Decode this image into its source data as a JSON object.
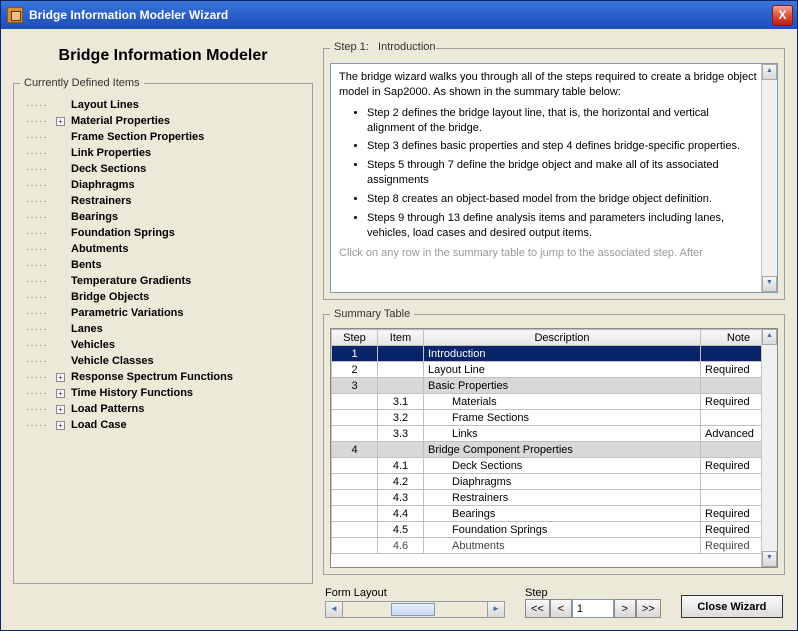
{
  "window": {
    "title": "Bridge Information Modeler Wizard",
    "close_x": "X"
  },
  "app": {
    "title": "Bridge Information Modeler"
  },
  "tree": {
    "legend": "Currently Defined Items",
    "items": [
      {
        "label": "Layout Lines",
        "expandable": false
      },
      {
        "label": "Material Properties",
        "expandable": true
      },
      {
        "label": "Frame Section Properties",
        "expandable": false
      },
      {
        "label": "Link Properties",
        "expandable": false
      },
      {
        "label": "Deck Sections",
        "expandable": false
      },
      {
        "label": "Diaphragms",
        "expandable": false
      },
      {
        "label": "Restrainers",
        "expandable": false
      },
      {
        "label": "Bearings",
        "expandable": false
      },
      {
        "label": "Foundation Springs",
        "expandable": false
      },
      {
        "label": "Abutments",
        "expandable": false
      },
      {
        "label": "Bents",
        "expandable": false
      },
      {
        "label": "Temperature Gradients",
        "expandable": false
      },
      {
        "label": "Bridge Objects",
        "expandable": false
      },
      {
        "label": "Parametric Variations",
        "expandable": false
      },
      {
        "label": "Lanes",
        "expandable": false
      },
      {
        "label": "Vehicles",
        "expandable": false
      },
      {
        "label": "Vehicle Classes",
        "expandable": false
      },
      {
        "label": "Response Spectrum Functions",
        "expandable": true
      },
      {
        "label": "Time History Functions",
        "expandable": true
      },
      {
        "label": "Load Patterns",
        "expandable": true
      },
      {
        "label": "Load Case",
        "expandable": true
      }
    ]
  },
  "step": {
    "header_prefix": "Step 1:",
    "header_title": "Introduction",
    "intro_para": "The bridge wizard walks you through all of the steps required to create a bridge object model in Sap2000. As shown in the summary table below:",
    "bullets": [
      "Step 2 defines the bridge layout line, that is, the horizontal and vertical alignment of the bridge.",
      "Step 3 defines basic properties and step 4 defines bridge-specific properties.",
      "Steps 5 through 7 define the bridge object and make all of its associated assignments",
      "Step 8 creates an object-based model from the bridge object definition.",
      "Steps 9 through 13 define analysis items and parameters including lanes, vehicles, load cases and desired output items."
    ],
    "cutoff": "Click on any row in the summary table to jump to the associated step. After"
  },
  "summary": {
    "legend": "Summary Table",
    "columns": {
      "step": "Step",
      "item": "Item",
      "description": "Description",
      "note": "Note"
    },
    "rows": [
      {
        "step": "1",
        "item": "",
        "desc": "Introduction",
        "note": "",
        "selected": true
      },
      {
        "step": "2",
        "item": "",
        "desc": "Layout Line",
        "note": "Required"
      },
      {
        "step": "3",
        "item": "",
        "desc": "Basic Properties",
        "note": "",
        "shade": true
      },
      {
        "step": "",
        "item": "3.1",
        "desc": "Materials",
        "note": "Required",
        "indent": true
      },
      {
        "step": "",
        "item": "3.2",
        "desc": "Frame Sections",
        "note": "",
        "indent": true
      },
      {
        "step": "",
        "item": "3.3",
        "desc": "Links",
        "note": "Advanced",
        "indent": true
      },
      {
        "step": "4",
        "item": "",
        "desc": "Bridge Component Properties",
        "note": "",
        "shade": true
      },
      {
        "step": "",
        "item": "4.1",
        "desc": "Deck Sections",
        "note": "Required",
        "indent": true
      },
      {
        "step": "",
        "item": "4.2",
        "desc": "Diaphragms",
        "note": "",
        "indent": true
      },
      {
        "step": "",
        "item": "4.3",
        "desc": "Restrainers",
        "note": "",
        "indent": true
      },
      {
        "step": "",
        "item": "4.4",
        "desc": "Bearings",
        "note": "Required",
        "indent": true
      },
      {
        "step": "",
        "item": "4.5",
        "desc": "Foundation Springs",
        "note": "Required",
        "indent": true
      },
      {
        "step": "",
        "item": "4.6",
        "desc": "Abutments",
        "note": "Required",
        "indent": true,
        "cut": true
      }
    ]
  },
  "footer": {
    "form_layout_label": "Form Layout",
    "step_label": "Step",
    "step_value": "1",
    "nav": {
      "first": "<<",
      "prev": "<",
      "next": ">",
      "last": ">>"
    },
    "close_label": "Close Wizard",
    "scroll": {
      "up": "▲",
      "down": "▼",
      "left": "◄",
      "right": "►"
    }
  }
}
